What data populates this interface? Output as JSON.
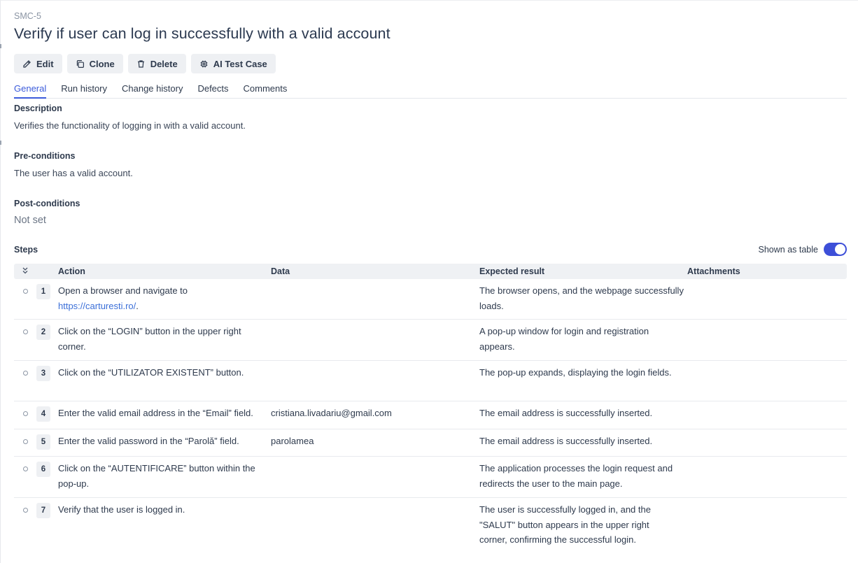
{
  "case": {
    "id": "SMC-5",
    "title": "Verify if user can log in successfully with a valid account"
  },
  "toolbar": {
    "edit_label": "Edit",
    "clone_label": "Clone",
    "delete_label": "Delete",
    "ai_label": "AI Test Case"
  },
  "tabs": [
    {
      "label": "General",
      "active": true
    },
    {
      "label": "Run history"
    },
    {
      "label": "Change history"
    },
    {
      "label": "Defects"
    },
    {
      "label": "Comments"
    }
  ],
  "description": {
    "label": "Description",
    "text": "Verifies the functionality of logging in with a valid account."
  },
  "preconditions": {
    "label": "Pre-conditions",
    "text": "The user has a valid account."
  },
  "postconditions": {
    "label": "Post-conditions",
    "text": "Not set"
  },
  "steps": {
    "label": "Steps",
    "toggle_label": "Shown as table",
    "toggle_on": true,
    "accent_color": "#3d4fd8",
    "columns": {
      "action": "Action",
      "data": "Data",
      "expected": "Expected result",
      "attachments": "Attachments"
    },
    "rows": [
      {
        "num": "1",
        "action": "Open a browser and navigate to",
        "action_link": "https://carturesti.ro/",
        "action_suffix": ".",
        "data": "",
        "expected": "The browser opens, and the webpage successfully loads."
      },
      {
        "num": "2",
        "action": "Click on the “LOGIN” button in the upper right corner.",
        "data": "",
        "expected": "A pop-up window for login and registration appears."
      },
      {
        "num": "3",
        "action": "Click on the “UTILIZATOR EXISTENT” button.",
        "data": "",
        "expected": "The pop-up expands, displaying the login fields."
      },
      {
        "num": "4",
        "action": "Enter the valid email address in the “Email” field.",
        "data": "cristiana.livadariu@gmail.com",
        "expected": "The email address is successfully inserted."
      },
      {
        "num": "5",
        "action": "Enter the valid password in the “Parolă” field.",
        "data": "parolamea",
        "expected": "The email address is successfully inserted."
      },
      {
        "num": "6",
        "action": "Click on the “AUTENTIFICARE” button within the pop-up.",
        "data": "",
        "expected": "The application processes the login request and redirects the user to the main page."
      },
      {
        "num": "7",
        "action": "Verify that the user is logged in.",
        "data": "",
        "expected": "The user is successfully logged in, and the \"SALUT\" button appears in the upper right corner, confirming the successful login."
      }
    ]
  }
}
